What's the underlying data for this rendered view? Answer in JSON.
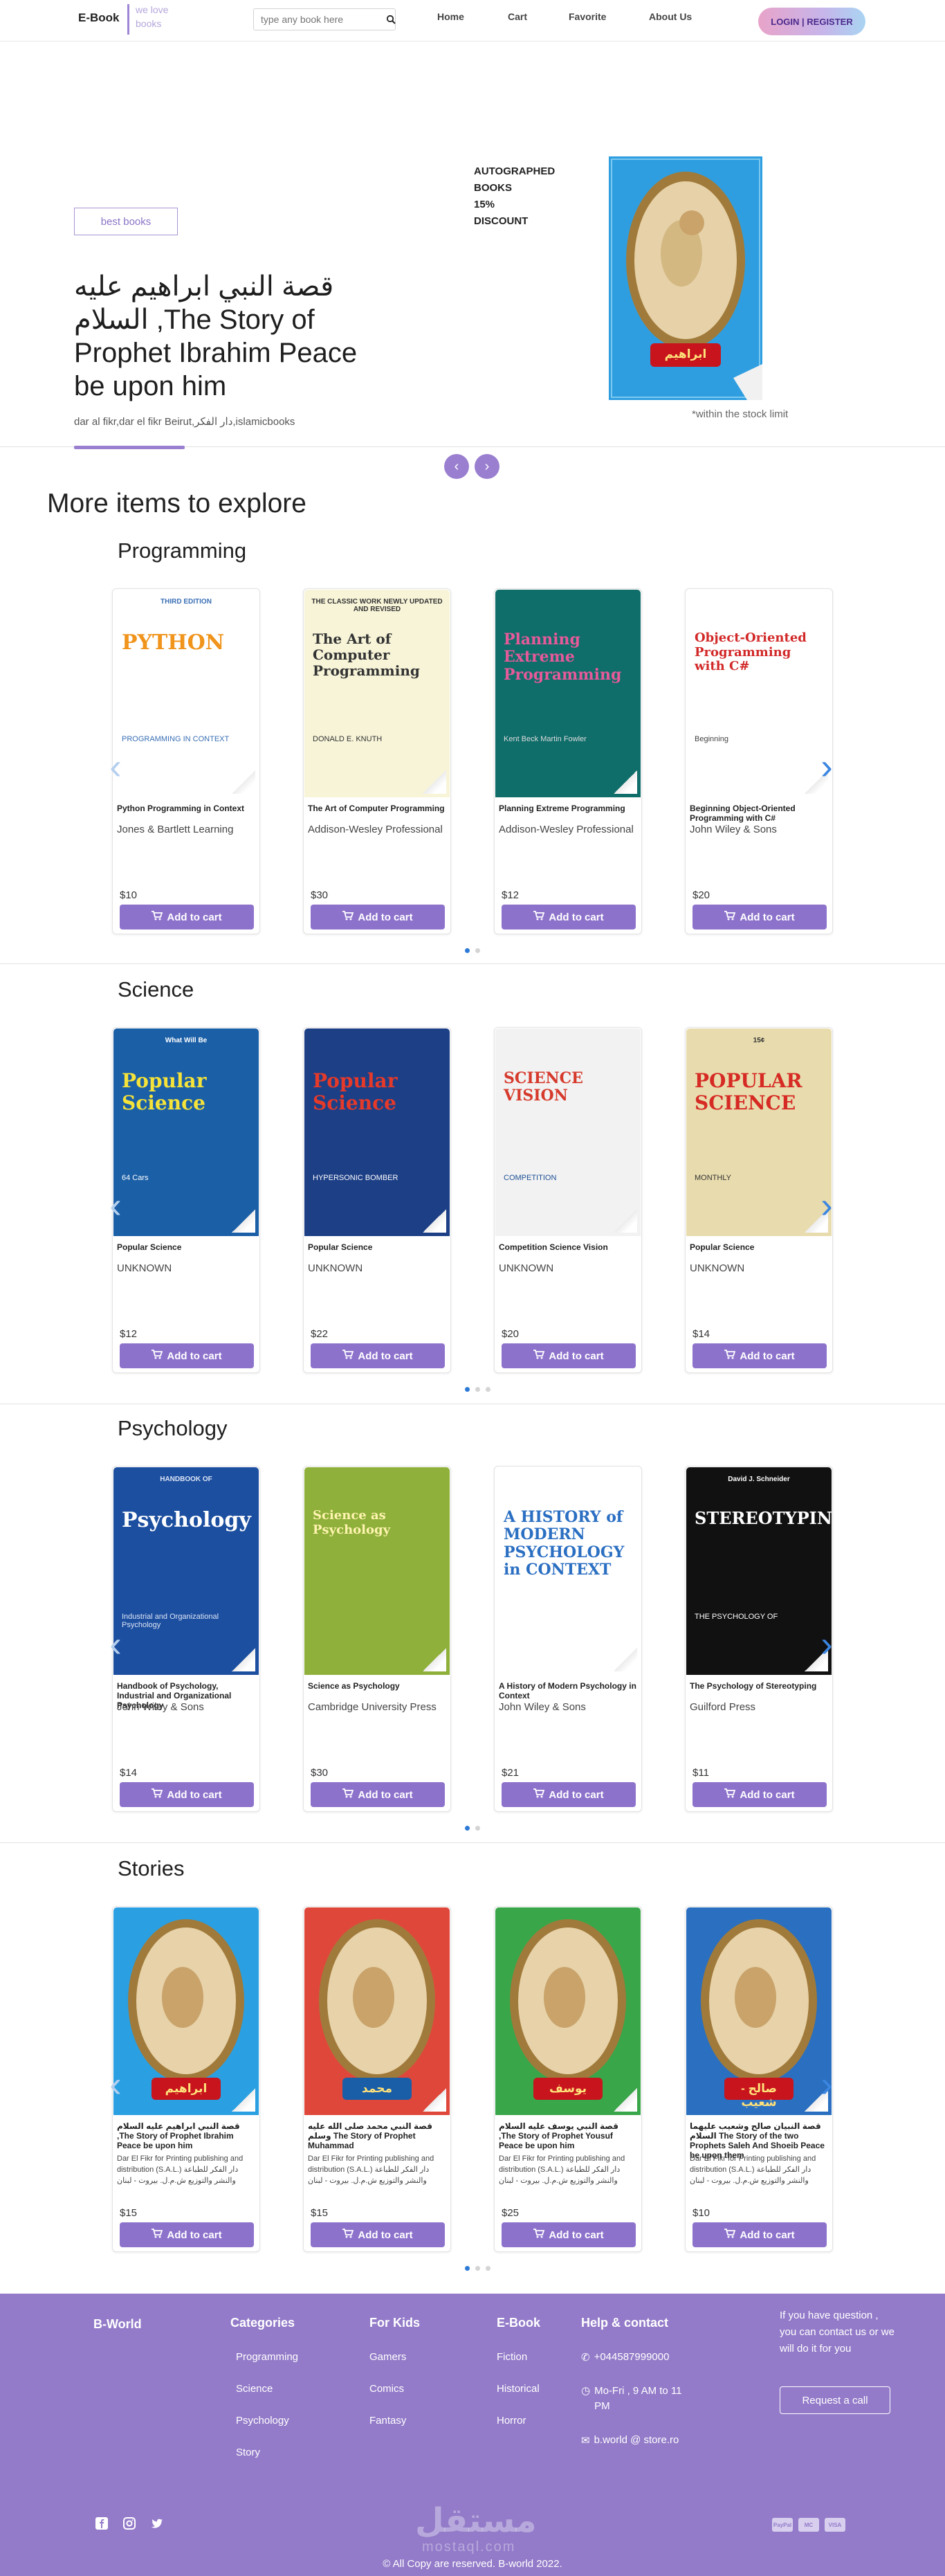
{
  "header": {
    "brand": "E-Book",
    "tagline_line1": "we love",
    "tagline_line2": "books",
    "search_placeholder": "type any book here",
    "nav": [
      "Home",
      "Cart",
      "Favorite",
      "About Us"
    ],
    "login": "LOGIN | REGISTER"
  },
  "hero": {
    "badge": "best books",
    "title": "قصة النبي ابراهيم عليه السلام ,The Story of Prophet Ibrahim Peace be upon him",
    "subtitle": "dar al fikr,dar el fikr Beirut,دار الفكر,islamicbooks",
    "promo_line1": "AUTOGRAPHED",
    "promo_line2": "BOOKS",
    "promo_line3": "15%",
    "promo_line4": "DISCOUNT",
    "stock_note": "*within the stock limit",
    "book_label": "ابراهيم"
  },
  "explore_title": "More items to explore",
  "add_to_cart": "Add to cart",
  "sections": [
    {
      "title": "Programming",
      "dots": 2,
      "active_dot": 0,
      "items": [
        {
          "title": "Python Programming in Context",
          "publisher": "Jones & Bartlett Learning",
          "price": "$10",
          "cover_text": "PYTHON",
          "cover_sub": "PROGRAMMING IN CONTEXT",
          "cover_badge": "THIRD EDITION"
        },
        {
          "title": "The Art of Computer Programming",
          "publisher": "Addison-Wesley Professional",
          "price": "$30",
          "cover_text": "The Art of Computer Programming",
          "cover_sub": "DONALD E. KNUTH",
          "cover_badge": "THE CLASSIC WORK NEWLY UPDATED AND REVISED"
        },
        {
          "title": "Planning Extreme Programming",
          "publisher": "Addison-Wesley Professional",
          "price": "$12",
          "cover_text": "Planning Extreme Programming",
          "cover_sub": "Kent Beck Martin Fowler",
          "cover_badge": ""
        },
        {
          "title": "Beginning Object-Oriented Programming with C#",
          "publisher": "John Wiley & Sons",
          "price": "$20",
          "cover_text": "Object-Oriented Programming with C#",
          "cover_sub": "Beginning",
          "cover_badge": ""
        }
      ]
    },
    {
      "title": "Science",
      "dots": 3,
      "active_dot": 0,
      "items": [
        {
          "title": "Popular Science",
          "publisher": "UNKNOWN",
          "price": "$12",
          "cover_text": "Popular Science",
          "cover_sub": "64 Cars",
          "cover_badge": "What Will Be"
        },
        {
          "title": "Popular Science",
          "publisher": "UNKNOWN",
          "price": "$22",
          "cover_text": "Popular Science",
          "cover_sub": "HYPERSONIC BOMBER",
          "cover_badge": ""
        },
        {
          "title": "Competition Science Vision",
          "publisher": "UNKNOWN",
          "price": "$20",
          "cover_text": "SCIENCE VISION",
          "cover_sub": "COMPETITION",
          "cover_badge": ""
        },
        {
          "title": "Popular Science",
          "publisher": "UNKNOWN",
          "price": "$14",
          "cover_text": "POPULAR SCIENCE",
          "cover_sub": "MONTHLY",
          "cover_badge": "15¢"
        }
      ]
    },
    {
      "title": "Psychology",
      "dots": 2,
      "active_dot": 0,
      "items": [
        {
          "title": "Handbook of Psychology, Industrial and Organizational Psychology",
          "publisher": "John Wiley & Sons",
          "price": "$14",
          "cover_text": "Psychology",
          "cover_sub": "Industrial and Organizational Psychology",
          "cover_badge": "HANDBOOK OF"
        },
        {
          "title": "Science as Psychology",
          "publisher": "Cambridge University Press",
          "price": "$30",
          "cover_text": "Science as Psychology",
          "cover_sub": "",
          "cover_badge": ""
        },
        {
          "title": "A History of Modern Psychology in Context",
          "publisher": "John Wiley & Sons",
          "price": "$21",
          "cover_text": "A HISTORY of MODERN PSYCHOLOGY in CONTEXT",
          "cover_sub": "",
          "cover_badge": ""
        },
        {
          "title": "The Psychology of Stereotyping",
          "publisher": "Guilford Press",
          "price": "$11",
          "cover_text": "STEREOTYPING",
          "cover_sub": "THE PSYCHOLOGY OF",
          "cover_badge": "David J. Schneider"
        }
      ]
    },
    {
      "title": "Stories",
      "dots": 3,
      "active_dot": 0,
      "items": [
        {
          "title": "قصة النبي ابراهيم عليه السلام ,The Story of Prophet Ibrahim Peace be upon him",
          "publisher": "Dar El Fikr for Printing publishing and distribution (S.A.L.) دار الفكر للطباعة والنشر والتوزيع ش.م.ل. بيروت - لبنان",
          "price": "$15",
          "cover_text": "ابراهيم",
          "cover_sub": "",
          "cover_badge": ""
        },
        {
          "title": "قصة النبي محمد صلى الله عليه وسلم The Story of Prophet Muhammad",
          "publisher": "Dar El Fikr for Printing publishing and distribution (S.A.L.) دار الفكر للطباعة والنشر والتوزيع ش.م.ل. بيروت - لبنان",
          "price": "$15",
          "cover_text": "محمد",
          "cover_sub": "",
          "cover_badge": ""
        },
        {
          "title": "قصة النبي يوسف عليه السلام ,The Story of Prophet Yousuf Peace be upon him",
          "publisher": "Dar El Fikr for Printing publishing and distribution (S.A.L.) دار الفكر للطباعة والنشر والتوزيع ش.م.ل. بيروت - لبنان",
          "price": "$25",
          "cover_text": "يوسف",
          "cover_sub": "",
          "cover_badge": ""
        },
        {
          "title": "قصة النبيان صالح وشعيب عليهما السلام The Story of the two Prophets Saleh And Shoeib Peace be upon them",
          "publisher": "Dar El Fikr for Printing publishing and distribution (S.A.L.) دار الفكر للطباعة والنشر والتوزيع ش.م.ل. بيروت - لبنان",
          "price": "$10",
          "cover_text": "صالح - شعيب",
          "cover_sub": "",
          "cover_badge": ""
        }
      ]
    }
  ],
  "footer": {
    "brand": "B-World",
    "categories_title": "Categories",
    "categories": [
      "Programming",
      "Science",
      "Psychology",
      "Story"
    ],
    "kids_title": "For Kids",
    "kids": [
      "Gamers",
      "Comics",
      "Fantasy"
    ],
    "ebook_title": "E-Book",
    "ebook": [
      "Fiction",
      "Historical",
      "Horror"
    ],
    "help_title": "Help & contact",
    "phone": "+044587999000",
    "hours": "Mo-Fri , 9 AM to 11 PM",
    "email": "b.world @ store.ro",
    "question": "If you have question , you can contact us or we will do it for you",
    "request_btn": "Request a call",
    "watermark": "مستقل",
    "watermark_sub": "mostaql.com",
    "payments": [
      "PayPal",
      "MC",
      "VISA"
    ],
    "copyright": "All Copy are reserved. B-world 2022."
  },
  "colors": {
    "accent": "#8d72cc",
    "footer": "#937bc9",
    "arrow": "#3b86e0"
  }
}
